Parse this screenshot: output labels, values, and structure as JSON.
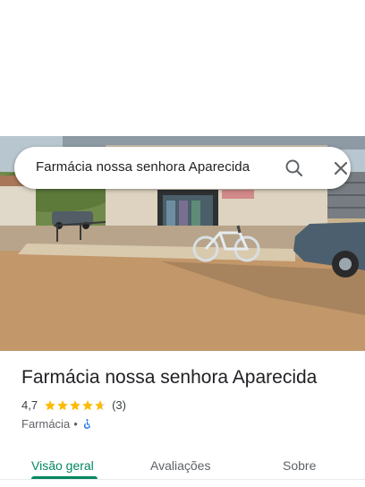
{
  "search": {
    "query": "Farmácia nossa senhora Aparecida"
  },
  "place": {
    "name": "Farmácia nossa senhora Aparecida",
    "rating": "4,7",
    "rating_value": 4.7,
    "review_count": "(3)",
    "category": "Farmácia",
    "separator": "•"
  },
  "tabs": [
    {
      "label": "Visão geral",
      "active": true
    },
    {
      "label": "Avaliações",
      "active": false
    },
    {
      "label": "Sobre",
      "active": false
    }
  ],
  "colors": {
    "accent": "#01875f",
    "star": "#fbbc04",
    "access": "#1a73e8"
  },
  "icons": {
    "search": "search-icon",
    "close": "close-icon",
    "accessibility": "wheelchair-icon"
  }
}
